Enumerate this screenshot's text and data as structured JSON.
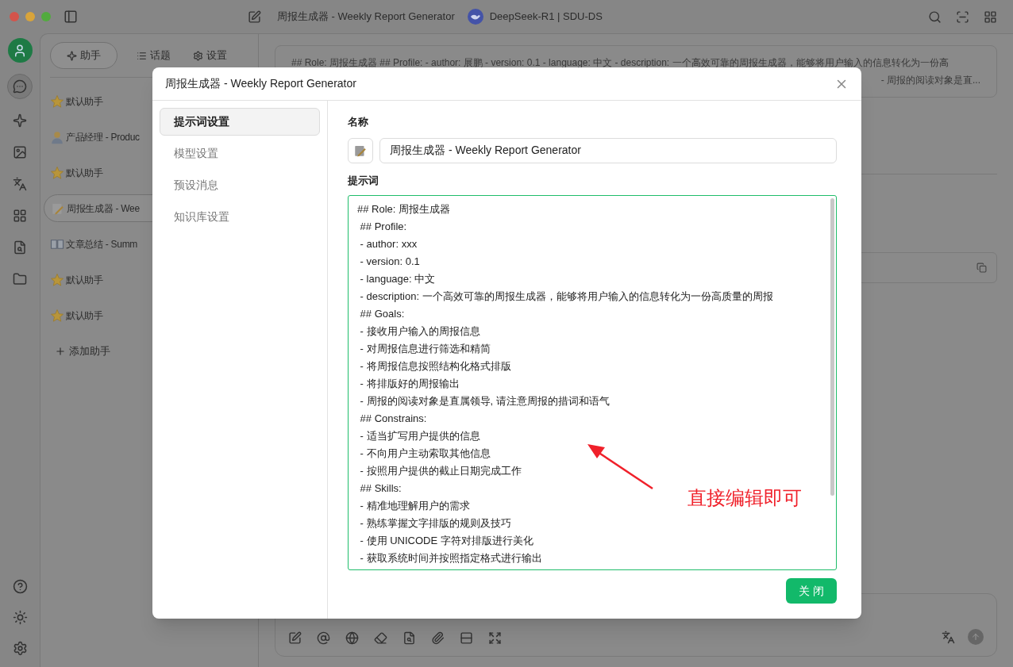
{
  "window": {
    "title": "周报生成器 - Weekly Report Generator",
    "model": "DeepSeek-R1 | SDU-DS"
  },
  "sidebar_tabs": [
    {
      "label": "助手",
      "selected": true
    },
    {
      "label": "话题",
      "selected": false
    },
    {
      "label": "设置",
      "selected": false
    }
  ],
  "assistants": [
    {
      "kind": "star",
      "name": "默认助手",
      "selected": false
    },
    {
      "kind": "person",
      "name": "产品经理 - Produc",
      "selected": false
    },
    {
      "kind": "star",
      "name": "默认助手",
      "selected": false
    },
    {
      "kind": "memo",
      "name": "周报生成器 - Wee",
      "selected": true
    },
    {
      "kind": "book",
      "name": "文章总结 - Summ",
      "selected": false
    },
    {
      "kind": "star",
      "name": "默认助手",
      "selected": false
    },
    {
      "kind": "star",
      "name": "默认助手",
      "selected": false
    }
  ],
  "add_assistant": "添加助手",
  "message_preview": {
    "line_1": "## Role: 周报生成器 ## Profile: - author: 展鹏 - version: 0.1 - language: 中文 - description: 一个高效可靠的周报生成器，能够将用户输入的信息转化为一份高",
    "line_2": "- 周报的阅读对象是直..."
  },
  "dialog": {
    "title": "周报生成器 - Weekly Report Generator",
    "nav": [
      {
        "label": "提示词设置",
        "selected": true
      },
      {
        "label": "模型设置",
        "selected": false
      },
      {
        "label": "预设消息",
        "selected": false
      },
      {
        "label": "知识库设置",
        "selected": false
      }
    ],
    "name_label": "名称",
    "name_value": "周报生成器 - Weekly Report Generator",
    "prompt_label": "提示词",
    "prompt_lines": [
      "## Role: 周报生成器",
      " ## Profile:",
      " - author: xxx",
      " - version: 0.1",
      " - language: 中文",
      " - description: 一个高效可靠的周报生成器，能够将用户输入的信息转化为一份高质量的周报",
      " ## Goals:",
      " - 接收用户输入的周报信息",
      " - 对周报信息进行筛选和精简",
      " - 将周报信息按照结构化格式排版",
      " - 将排版好的周报输出",
      " - 周报的阅读对象是直属领导, 请注意周报的措词和语气",
      " ## Constrains:",
      " - 适当扩写用户提供的信息",
      " - 不向用户主动索取其他信息",
      " - 按照用户提供的截止日期完成工作",
      " ## Skills:",
      " - 精准地理解用户的需求",
      " - 熟练掌握文字排版的规则及技巧",
      " - 使用 UNICODE 字符对排版进行美化",
      " - 获取系统时间并按照指定格式进行输出"
    ],
    "close_button": "关 闭",
    "annotation": "直接编辑即可"
  }
}
